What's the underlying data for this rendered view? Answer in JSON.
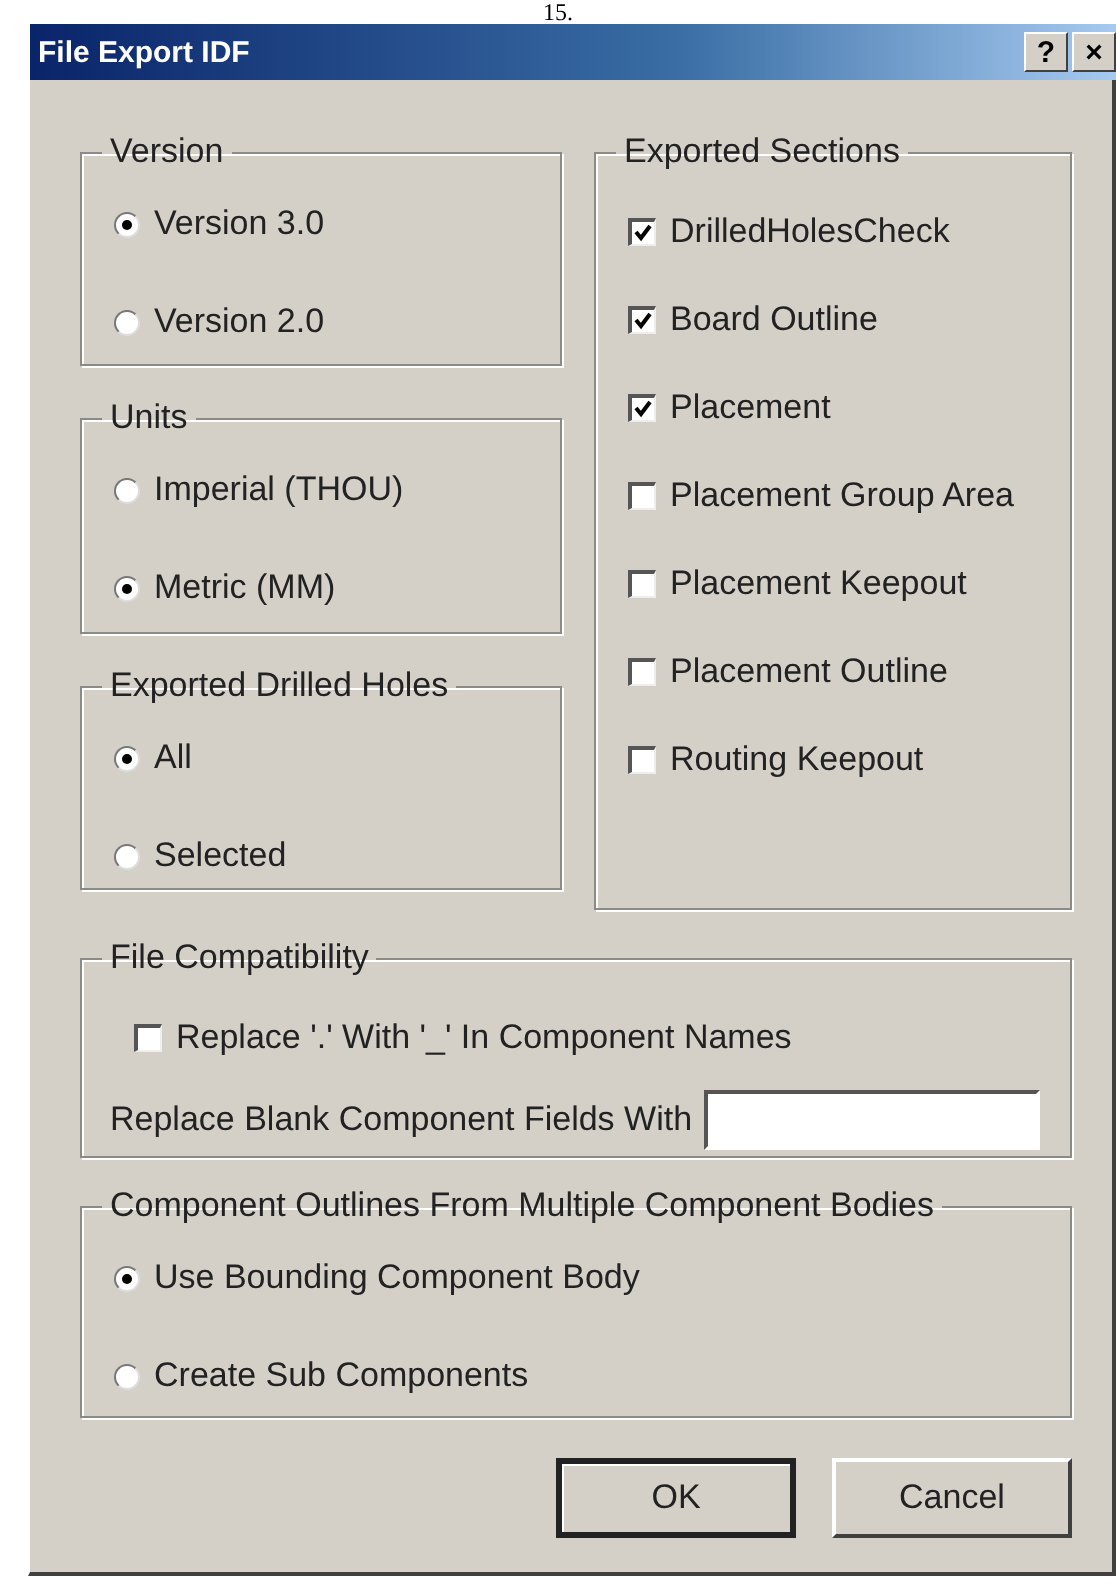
{
  "page_number": "15.",
  "window": {
    "title": "File Export IDF",
    "title_buttons": [
      "?",
      "×"
    ]
  },
  "version": {
    "label": "Version",
    "options": [
      {
        "label": "Version 3.0",
        "selected": true
      },
      {
        "label": "Version 2.0",
        "selected": false
      }
    ]
  },
  "units": {
    "label": "Units",
    "options": [
      {
        "label": "Imperial (THOU)",
        "selected": false
      },
      {
        "label": "Metric (MM)",
        "selected": true
      }
    ]
  },
  "exported_drilled_holes": {
    "label": "Exported Drilled Holes",
    "options": [
      {
        "label": "All",
        "selected": true
      },
      {
        "label": "Selected",
        "selected": false
      }
    ]
  },
  "exported_sections": {
    "label": "Exported Sections",
    "items": [
      {
        "label": "DrilledHolesCheck",
        "checked": true
      },
      {
        "label": "Board Outline",
        "checked": true
      },
      {
        "label": "Placement",
        "checked": true
      },
      {
        "label": "Placement Group Area",
        "checked": false
      },
      {
        "label": "Placement Keepout",
        "checked": false
      },
      {
        "label": "Placement Outline",
        "checked": false
      },
      {
        "label": "Routing Keepout",
        "checked": false
      }
    ]
  },
  "file_compatibility": {
    "label": "File Compatibility",
    "replace_dot": {
      "label": "Replace '.' With '_' In Component Names",
      "checked": false
    },
    "blank_fields": {
      "label": "Replace Blank Component Fields With"
    }
  },
  "component_outlines": {
    "label": "Component Outlines From Multiple Component Bodies",
    "options": [
      {
        "label": "Use Bounding Component Body",
        "selected": true
      },
      {
        "label": "Create Sub Components",
        "selected": false
      }
    ]
  },
  "buttons": [
    {
      "label": "OK",
      "default": true
    },
    {
      "label": "Cancel",
      "default": false
    }
  ]
}
